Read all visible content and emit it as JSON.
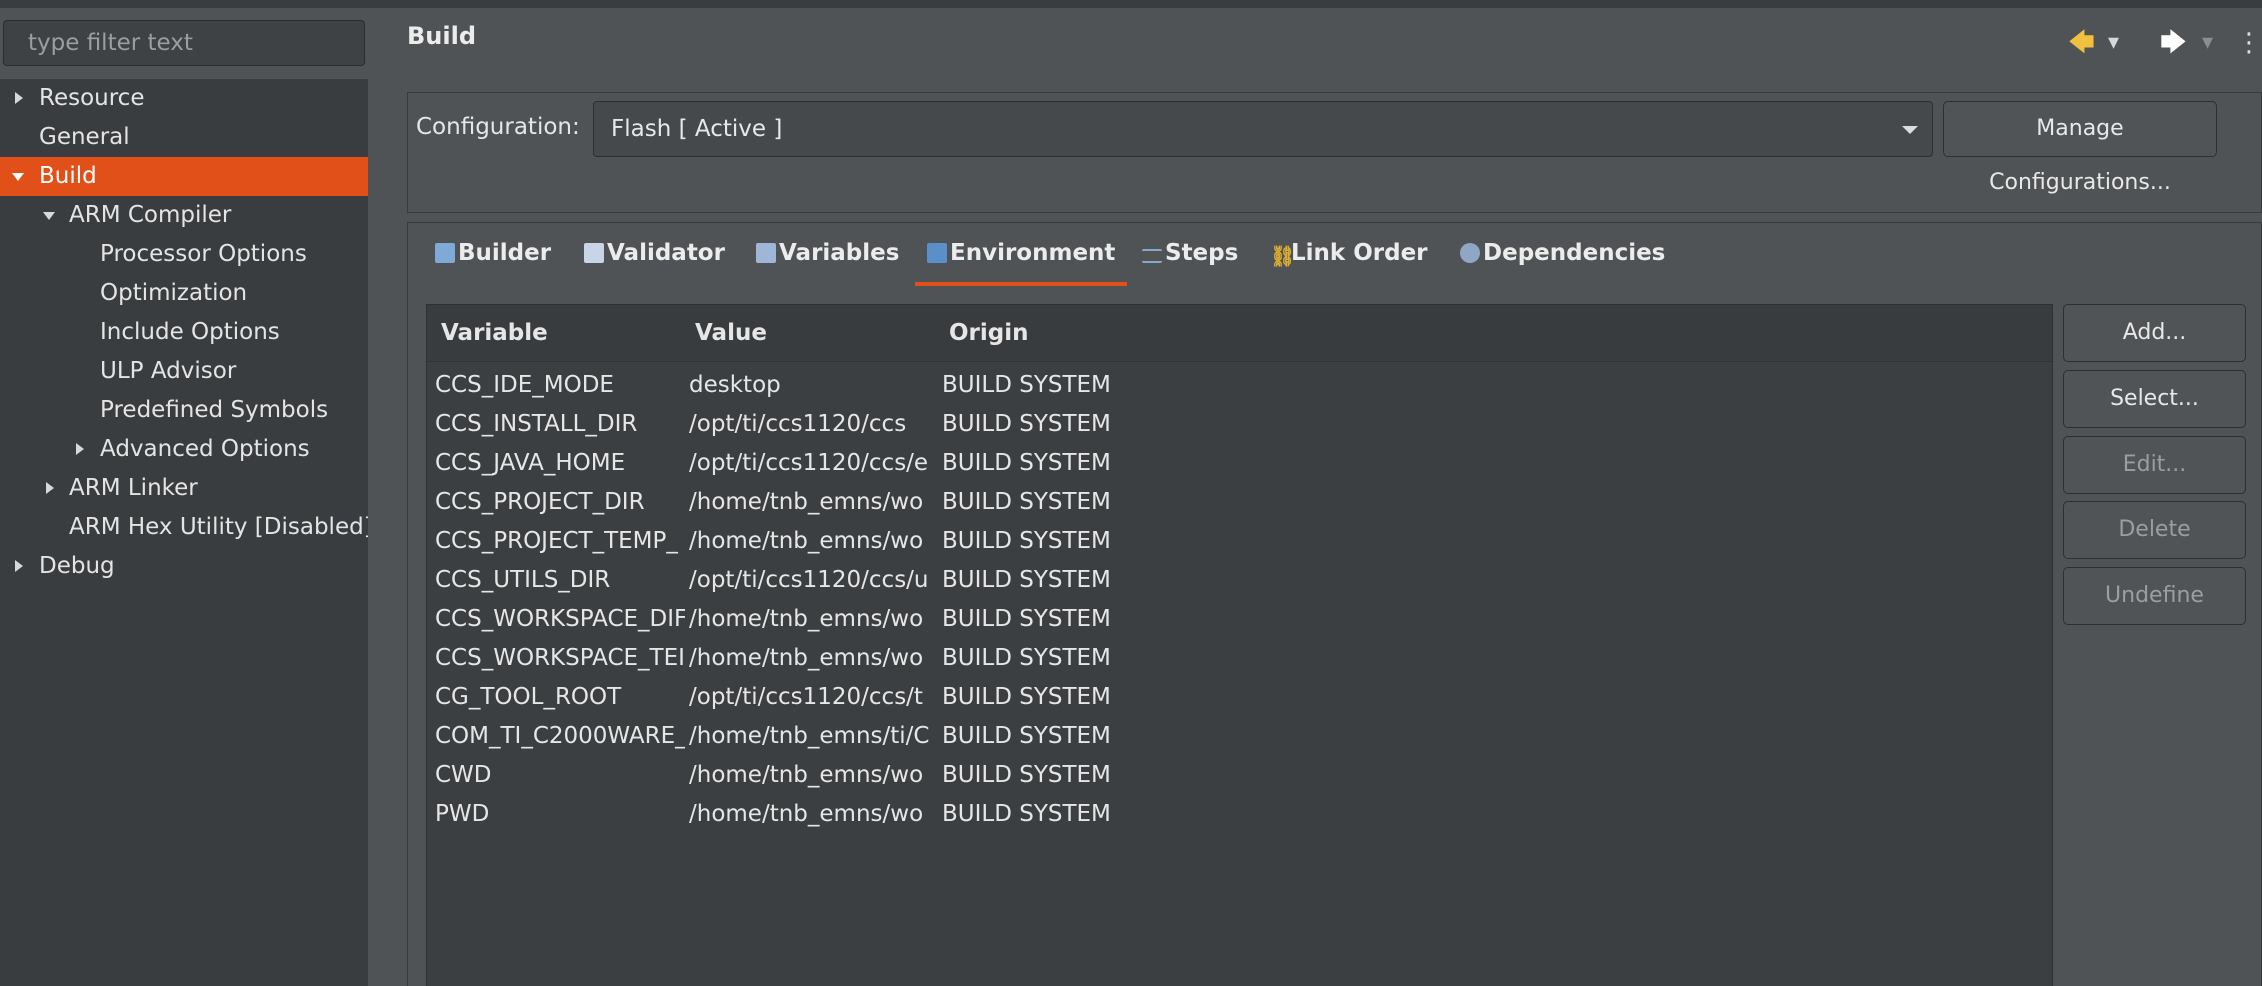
{
  "filter": {
    "placeholder": "type filter text"
  },
  "tree": {
    "items": [
      {
        "label": "Resource",
        "twisty": "right",
        "selected": false
      },
      {
        "label": "General",
        "twisty": "",
        "selected": false
      },
      {
        "label": "Build",
        "twisty": "down",
        "selected": true
      },
      {
        "label": "ARM Compiler",
        "twisty": "down",
        "selected": false
      },
      {
        "label": "Processor Options",
        "twisty": "",
        "selected": false
      },
      {
        "label": "Optimization",
        "twisty": "",
        "selected": false
      },
      {
        "label": "Include Options",
        "twisty": "",
        "selected": false
      },
      {
        "label": "ULP Advisor",
        "twisty": "",
        "selected": false
      },
      {
        "label": "Predefined Symbols",
        "twisty": "",
        "selected": false
      },
      {
        "label": "Advanced Options",
        "twisty": "right",
        "selected": false
      },
      {
        "label": "ARM Linker",
        "twisty": "right",
        "selected": false
      },
      {
        "label": "ARM Hex Utility  [Disabled]",
        "twisty": "",
        "selected": false
      },
      {
        "label": "Debug",
        "twisty": "right",
        "selected": false
      }
    ]
  },
  "page": {
    "title": "Build"
  },
  "nav": {
    "back": "🡄",
    "back_menu": "▾",
    "forward": "🡆",
    "forward_menu": "▾",
    "more": "⋮"
  },
  "config": {
    "label": "Configuration:",
    "value": "Flash  [ Active ]",
    "manage_label": "Manage Configurations..."
  },
  "tabs": [
    {
      "label": "Builder",
      "icon": "builder-icon",
      "active": false
    },
    {
      "label": "Validator",
      "icon": "validator-icon",
      "active": false
    },
    {
      "label": "Variables",
      "icon": "variables-icon",
      "active": false
    },
    {
      "label": "Environment",
      "icon": "environment-icon",
      "active": true
    },
    {
      "label": "Steps",
      "icon": "steps-icon",
      "active": false
    },
    {
      "label": "Link Order",
      "icon": "link-order-icon",
      "active": false
    },
    {
      "label": "Dependencies",
      "icon": "dependencies-icon",
      "active": false
    }
  ],
  "table": {
    "columns": [
      "Variable",
      "Value",
      "Origin"
    ],
    "rows": [
      [
        "CCS_IDE_MODE",
        "desktop",
        "BUILD SYSTEM"
      ],
      [
        "CCS_INSTALL_DIR",
        "/opt/ti/ccs1120/ccs",
        "BUILD SYSTEM"
      ],
      [
        "CCS_JAVA_HOME",
        "/opt/ti/ccs1120/ccs/e",
        "BUILD SYSTEM"
      ],
      [
        "CCS_PROJECT_DIR",
        "/home/tnb_emns/wo",
        "BUILD SYSTEM"
      ],
      [
        "CCS_PROJECT_TEMP_",
        "/home/tnb_emns/wo",
        "BUILD SYSTEM"
      ],
      [
        "CCS_UTILS_DIR",
        "/opt/ti/ccs1120/ccs/u",
        "BUILD SYSTEM"
      ],
      [
        "CCS_WORKSPACE_DIF",
        "/home/tnb_emns/wo",
        "BUILD SYSTEM"
      ],
      [
        "CCS_WORKSPACE_TEI",
        "/home/tnb_emns/wo",
        "BUILD SYSTEM"
      ],
      [
        "CG_TOOL_ROOT",
        "/opt/ti/ccs1120/ccs/t",
        "BUILD SYSTEM"
      ],
      [
        "COM_TI_C2000WARE_",
        "/home/tnb_emns/ti/C",
        "BUILD SYSTEM"
      ],
      [
        "CWD",
        "/home/tnb_emns/wo",
        "BUILD SYSTEM"
      ],
      [
        "PWD",
        "/home/tnb_emns/wo",
        "BUILD SYSTEM"
      ]
    ]
  },
  "buttons": [
    {
      "label": "Add...",
      "enabled": true,
      "name": "add-button"
    },
    {
      "label": "Select...",
      "enabled": true,
      "name": "select-button"
    },
    {
      "label": "Edit...",
      "enabled": false,
      "name": "edit-button"
    },
    {
      "label": "Delete",
      "enabled": false,
      "name": "delete-button"
    },
    {
      "label": "Undefine",
      "enabled": false,
      "name": "undefine-button"
    }
  ],
  "colors": {
    "accent": "#e2501a",
    "panel": "#4f5355",
    "tree_bg": "#3a3d3f",
    "table_bg": "#3c3f41"
  }
}
